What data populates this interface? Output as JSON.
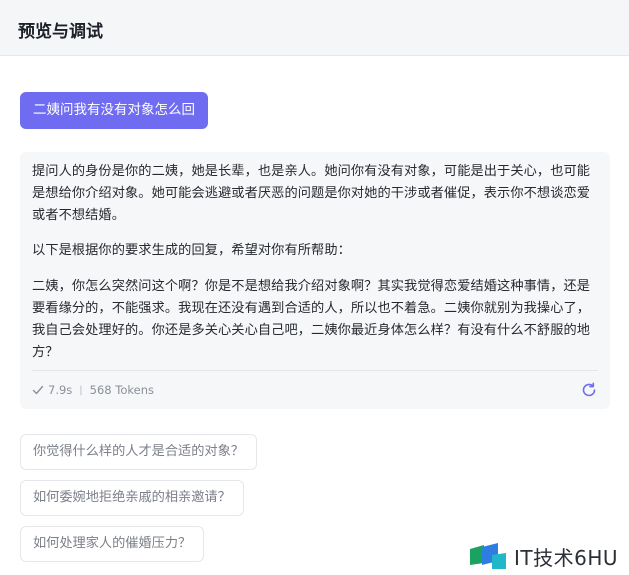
{
  "header": {
    "title": "预览与调试"
  },
  "user_message": {
    "text": "二姨问我有没有对象怎么回"
  },
  "answer": {
    "paragraphs": [
      "提问人的身份是你的二姨，她是长辈，也是亲人。她问你有没有对象，可能是出于关心，也可能是想给你介绍对象。她可能会逃避或者厌恶的问题是你对她的干涉或者催促，表示你不想谈恋爱或者不想结婚。",
      "以下是根据你的要求生成的回复，希望对你有所帮助：",
      "二姨，你怎么突然问这个啊？你是不是想给我介绍对象啊？其实我觉得恋爱结婚这种事情，还是要看缘分的，不能强求。我现在还没有遇到合适的人，所以也不着急。二姨你就别为我操心了，我自己会处理好的。你还是多关心关心自己吧，二姨你最近身体怎么样？有没有什么不舒服的地方？"
    ],
    "meta": {
      "time": "7.9s",
      "tokens": "568 Tokens"
    },
    "icons": {
      "check": "check-icon",
      "refresh": "refresh-icon"
    },
    "accent_color": "#6f6cf1"
  },
  "suggestions": [
    "你觉得什么样的人才是合适的对象？",
    "如何委婉地拒绝亲戚的相亲邀请？",
    "如何处理家人的催婚压力？"
  ],
  "watermark": {
    "text": "IT技术6HU"
  }
}
